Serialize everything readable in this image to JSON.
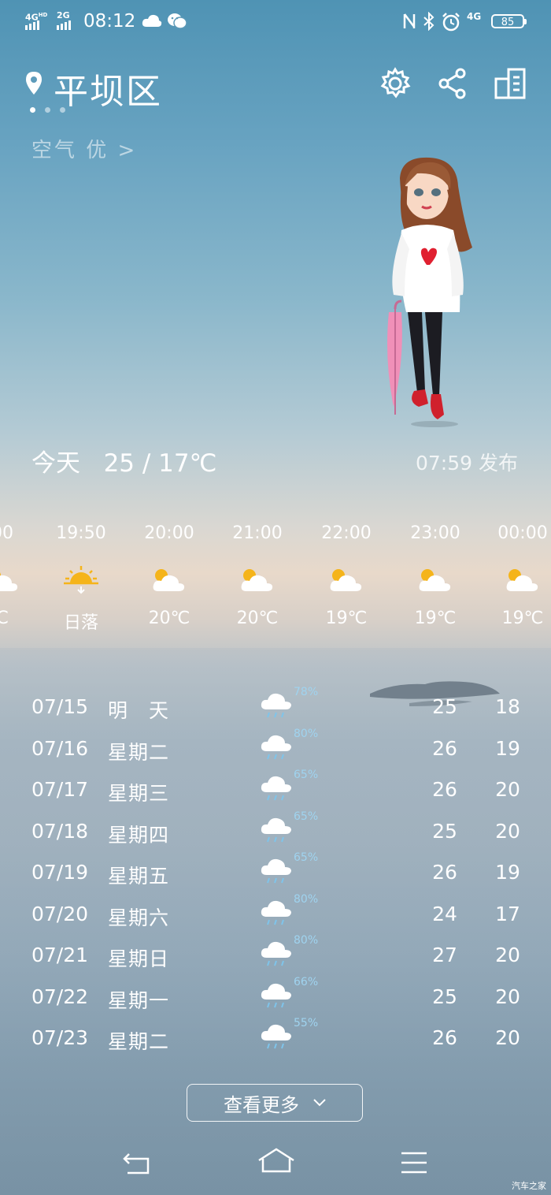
{
  "status_bar": {
    "net1": "4G",
    "net1_sup": "HD",
    "net2": "2G",
    "time": "08:12",
    "net3": "4G",
    "battery": "85"
  },
  "header": {
    "location": "平坝区",
    "air_quality": "空气 优"
  },
  "today": {
    "label": "今天",
    "temp": "25 / 17℃",
    "publish": "07:59 发布"
  },
  "hourly": [
    {
      "time": "00",
      "label": "C",
      "icon": "partly-cloudy-icon"
    },
    {
      "time": "19:50",
      "label": "日落",
      "icon": "sunset-icon"
    },
    {
      "time": "20:00",
      "label": "20℃",
      "icon": "partly-cloudy-icon"
    },
    {
      "time": "21:00",
      "label": "20℃",
      "icon": "partly-cloudy-icon"
    },
    {
      "time": "22:00",
      "label": "19℃",
      "icon": "partly-cloudy-icon"
    },
    {
      "time": "23:00",
      "label": "19℃",
      "icon": "partly-cloudy-icon"
    },
    {
      "time": "00:00",
      "label": "19℃",
      "icon": "partly-cloudy-icon"
    }
  ],
  "daily": [
    {
      "date": "07/15",
      "weekday": "明　天",
      "pop": "78%",
      "high": "25",
      "low": "18"
    },
    {
      "date": "07/16",
      "weekday": "星期二",
      "pop": "80%",
      "high": "26",
      "low": "19"
    },
    {
      "date": "07/17",
      "weekday": "星期三",
      "pop": "65%",
      "high": "26",
      "low": "20"
    },
    {
      "date": "07/18",
      "weekday": "星期四",
      "pop": "65%",
      "high": "25",
      "low": "20"
    },
    {
      "date": "07/19",
      "weekday": "星期五",
      "pop": "65%",
      "high": "26",
      "low": "19"
    },
    {
      "date": "07/20",
      "weekday": "星期六",
      "pop": "80%",
      "high": "24",
      "low": "17"
    },
    {
      "date": "07/21",
      "weekday": "星期日",
      "pop": "80%",
      "high": "27",
      "low": "20"
    },
    {
      "date": "07/22",
      "weekday": "星期一",
      "pop": "66%",
      "high": "25",
      "low": "20"
    },
    {
      "date": "07/23",
      "weekday": "星期二",
      "pop": "55%",
      "high": "26",
      "low": "20"
    }
  ],
  "more_button": "查看更多",
  "watermark": "汽车之家",
  "colors": {
    "rain_pop": "#9fd3ef",
    "heart": "#e02030",
    "umbrella": "#f090b8",
    "sun": "#f5b41a"
  }
}
